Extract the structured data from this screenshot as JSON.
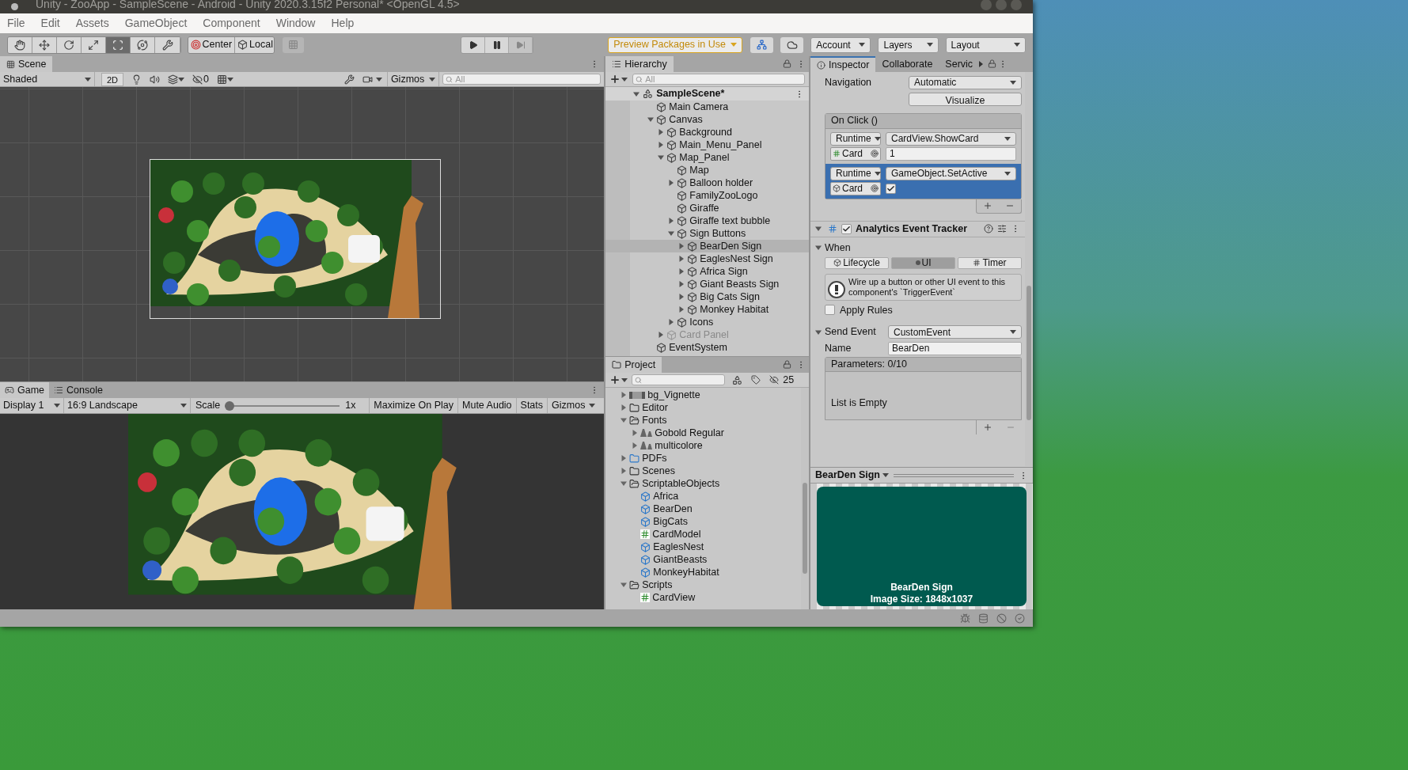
{
  "window": {
    "title": "Unity - ZooApp - SampleScene - Android - Unity 2020.3.15f2 Personal* <OpenGL 4.5>"
  },
  "menu": [
    "File",
    "Edit",
    "Assets",
    "GameObject",
    "Component",
    "Window",
    "Help"
  ],
  "toolbar": {
    "tools": [
      {
        "kind": "hand",
        "selected": false
      },
      {
        "kind": "move",
        "selected": false
      },
      {
        "kind": "rotate",
        "selected": false
      },
      {
        "kind": "scale",
        "selected": false
      },
      {
        "kind": "rect",
        "selected": true
      },
      {
        "kind": "transform",
        "selected": false
      },
      {
        "kind": "custom",
        "selected": false
      }
    ],
    "pivot": [
      {
        "kind": "center",
        "label": "Center"
      },
      {
        "kind": "local",
        "label": "Local"
      }
    ],
    "playback": [
      {
        "kind": "play",
        "on": false
      },
      {
        "kind": "pause",
        "on": false
      },
      {
        "kind": "step",
        "on": false
      }
    ],
    "packages": "Preview Packages in Use",
    "dropdowns": [
      "Account",
      "Layers",
      "Layout"
    ]
  },
  "scene": {
    "tab": {
      "label": "Scene",
      "selected": true
    },
    "shading": "Shaded",
    "mode_2d": {
      "label": "2D",
      "on": false
    },
    "hidden_count": "0",
    "gizmos": "Gizmos",
    "search": {
      "placeholder": "All"
    }
  },
  "game": {
    "tabs": [
      {
        "kind": "game",
        "label": "Game",
        "selected": true
      },
      {
        "kind": "console",
        "label": "Console",
        "selected": false
      }
    ],
    "display": "Display 1",
    "aspect": "16:9 Landscape",
    "scale": {
      "label": "Scale",
      "level": 0,
      "reading": "1x"
    },
    "toggles": [
      {
        "label": "Maximize On Play",
        "on": false
      },
      {
        "label": "Mute Audio",
        "on": false
      },
      {
        "label": "Stats",
        "on": false
      },
      {
        "label": "Gizmos",
        "on": false
      }
    ]
  },
  "hierarchy": {
    "tab": "Hierarchy",
    "search": {
      "placeholder": "All"
    },
    "scene": {
      "name": "SampleScene*",
      "expanded": true
    },
    "items": [
      {
        "name": "Main Camera",
        "selected": false,
        "disabled": false
      },
      {
        "name": "Canvas",
        "expanded": true,
        "selected": false,
        "disabled": false,
        "children": [
          {
            "name": "Background",
            "expanded": false,
            "selected": false,
            "disabled": false
          },
          {
            "name": "Main_Menu_Panel",
            "expanded": false,
            "selected": false,
            "disabled": false
          },
          {
            "name": "Map_Panel",
            "expanded": true,
            "selected": false,
            "disabled": false,
            "children": [
              {
                "name": "Map",
                "selected": false,
                "disabled": false
              },
              {
                "name": "Balloon holder",
                "expanded": false,
                "selected": false,
                "disabled": false
              },
              {
                "name": "FamilyZooLogo",
                "selected": false,
                "disabled": false
              },
              {
                "name": "Giraffe",
                "selected": false,
                "disabled": false
              },
              {
                "name": "Giraffe text bubble",
                "expanded": false,
                "selected": false,
                "disabled": false
              },
              {
                "name": "Sign Buttons",
                "expanded": true,
                "selected": false,
                "disabled": false,
                "children": [
                  {
                    "name": "BearDen Sign",
                    "expanded": false,
                    "selected": true,
                    "disabled": false
                  },
                  {
                    "name": "EaglesNest Sign",
                    "expanded": false,
                    "selected": false,
                    "disabled": false
                  },
                  {
                    "name": "Africa Sign",
                    "expanded": false,
                    "selected": false,
                    "disabled": false
                  },
                  {
                    "name": "Giant Beasts Sign",
                    "expanded": false,
                    "selected": false,
                    "disabled": false
                  },
                  {
                    "name": "Big Cats Sign",
                    "expanded": false,
                    "selected": false,
                    "disabled": false
                  },
                  {
                    "name": "Monkey Habitat",
                    "expanded": false,
                    "selected": false,
                    "disabled": false
                  }
                ]
              },
              {
                "name": "Icons",
                "expanded": false,
                "selected": false,
                "disabled": false
              }
            ]
          },
          {
            "name": "Card Panel",
            "expanded": false,
            "selected": false,
            "disabled": true
          }
        ]
      },
      {
        "name": "EventSystem",
        "selected": false,
        "disabled": false
      }
    ]
  },
  "project": {
    "tab": "Project",
    "hidden_count": "25",
    "items": [
      {
        "name": "bg_Vignette",
        "expanded": false
      },
      {
        "kind": "folder",
        "name": "Editor",
        "expanded": false
      },
      {
        "kind": "folder",
        "name": "Fonts",
        "expanded": true,
        "children": [
          {
            "kind": "font",
            "name": "Gobold Regular",
            "expanded": false
          },
          {
            "kind": "font",
            "name": "multicolore",
            "expanded": false
          }
        ]
      },
      {
        "kind": "pdf-folder",
        "name": "PDFs",
        "expanded": false
      },
      {
        "kind": "folder",
        "name": "Scenes",
        "expanded": false
      },
      {
        "kind": "folder",
        "name": "ScriptableObjects",
        "expanded": true,
        "children": [
          {
            "kind": "asset",
            "name": "Africa"
          },
          {
            "kind": "asset",
            "name": "BearDen"
          },
          {
            "kind": "asset",
            "name": "BigCats"
          },
          {
            "kind": "script",
            "name": "CardModel"
          },
          {
            "kind": "asset",
            "name": "EaglesNest"
          },
          {
            "kind": "asset",
            "name": "GiantBeasts"
          },
          {
            "kind": "asset",
            "name": "MonkeyHabitat"
          }
        ]
      },
      {
        "kind": "folder",
        "name": "Scripts",
        "expanded": true,
        "children": [
          {
            "kind": "script",
            "name": "CardView"
          }
        ]
      }
    ]
  },
  "inspector": {
    "tabs": [
      {
        "label": "Inspector",
        "selected": true
      },
      {
        "label": "Collaborate",
        "selected": false
      },
      {
        "label": "Servic",
        "selected": false
      }
    ],
    "navigation": {
      "label": "Navigation",
      "value": "Automatic"
    },
    "visualize": "Visualize",
    "on_click": {
      "title": "On Click ()",
      "entries": [
        {
          "kind": "text",
          "mode": "Runtime",
          "function": "CardView.ShowCard",
          "target": "Card",
          "value": "1",
          "selected": false
        },
        {
          "kind": "checkbox",
          "mode": "Runtime",
          "function": "GameObject.SetActive",
          "target": "Card",
          "checked": true,
          "selected": true
        }
      ]
    },
    "component": {
      "title": "Analytics Event Tracker",
      "enabled": true,
      "expanded": true,
      "when": {
        "label": "When",
        "expanded": true,
        "options": [
          {
            "kind": "lifecycle",
            "label": "Lifecycle",
            "selected": false
          },
          {
            "kind": "ui",
            "label": "UI",
            "selected": true
          },
          {
            "kind": "timer",
            "label": "Timer",
            "selected": false
          }
        ]
      },
      "help": "Wire up a button or other UI event to this component's `TriggerEvent`",
      "apply_rules": {
        "label": "Apply Rules",
        "checked": false
      },
      "send_event": {
        "label": "Send Event",
        "value": "CustomEvent",
        "expanded": true
      },
      "name": {
        "label": "Name",
        "value": "BearDen"
      },
      "parameters": {
        "title": "Parameters: 0/10",
        "empty": "List is Empty"
      }
    }
  },
  "preview": {
    "title": "BearDen Sign",
    "name": "BearDen Sign",
    "size": "Image Size: 1848x1037"
  }
}
